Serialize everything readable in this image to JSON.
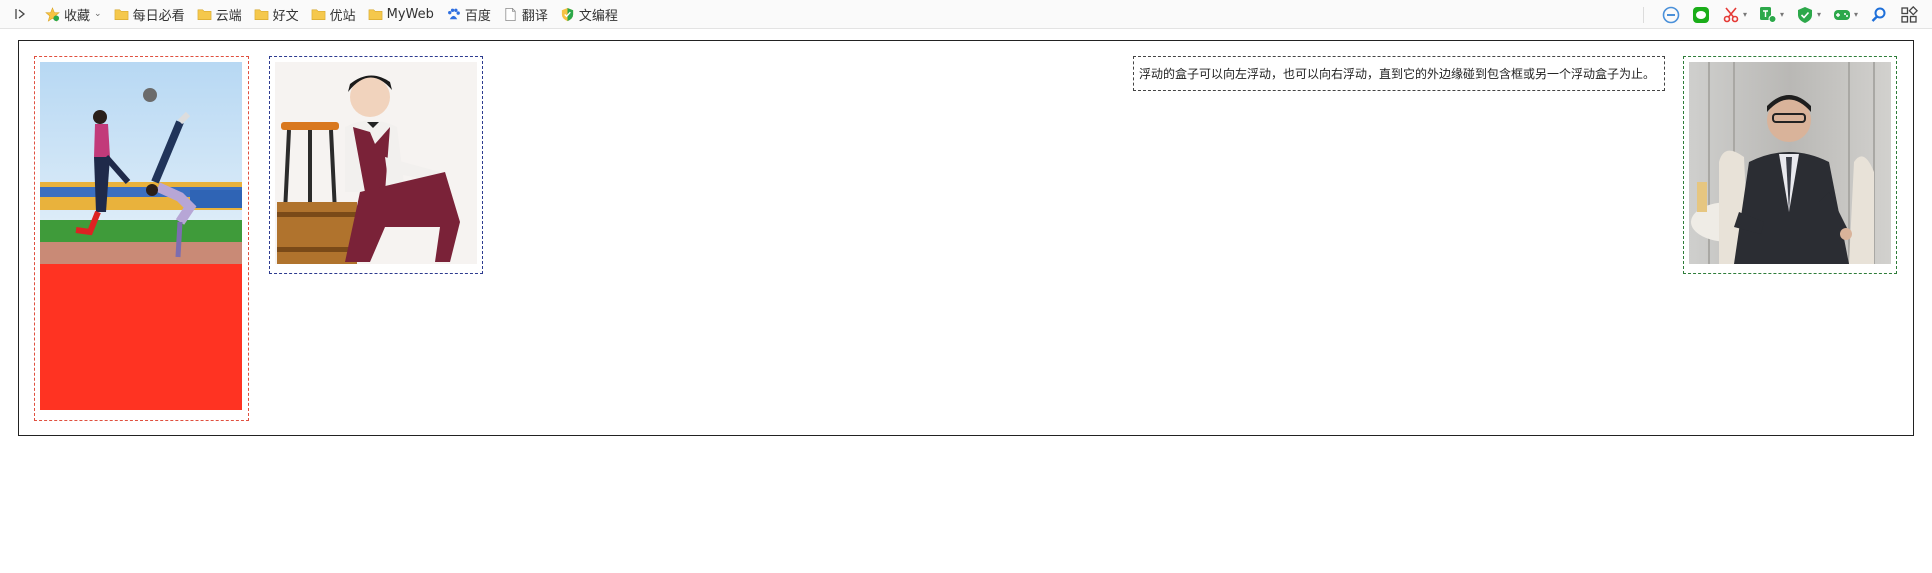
{
  "bookmarks": [
    {
      "label": "收藏",
      "icon": "star-icon",
      "dropdown": true
    },
    {
      "label": "每日必看",
      "icon": "folder-icon"
    },
    {
      "label": "云端",
      "icon": "folder-icon"
    },
    {
      "label": "好文",
      "icon": "folder-icon"
    },
    {
      "label": "优站",
      "icon": "folder-icon"
    },
    {
      "label": "MyWeb",
      "icon": "folder-icon"
    },
    {
      "label": "百度",
      "icon": "baidu-paw-icon"
    },
    {
      "label": "翻译",
      "icon": "page-icon"
    },
    {
      "label": "文编程",
      "icon": "shield-icon"
    }
  ],
  "extensions": [
    {
      "name": "minus-circle-icon",
      "color": "#4a90d9"
    },
    {
      "name": "wechat-icon",
      "color": "#1aad19"
    },
    {
      "name": "scissors-icon",
      "color": "#e53935"
    },
    {
      "name": "translate-icon",
      "color": "#2ca84a"
    },
    {
      "name": "shield-check-icon",
      "color": "#2ca84a"
    },
    {
      "name": "gamepad-icon",
      "color": "#2ca84a"
    },
    {
      "name": "search-icon",
      "color": "#1e6fd9"
    },
    {
      "name": "apps-grid-icon",
      "color": "#444444"
    }
  ],
  "demo": {
    "text_box": "浮动的盒子可以向左浮动，也可以向右浮动，直到它的外边缘碰到包含框或另一个浮动盒子为止。",
    "red_fill_color": "#ff3322"
  }
}
